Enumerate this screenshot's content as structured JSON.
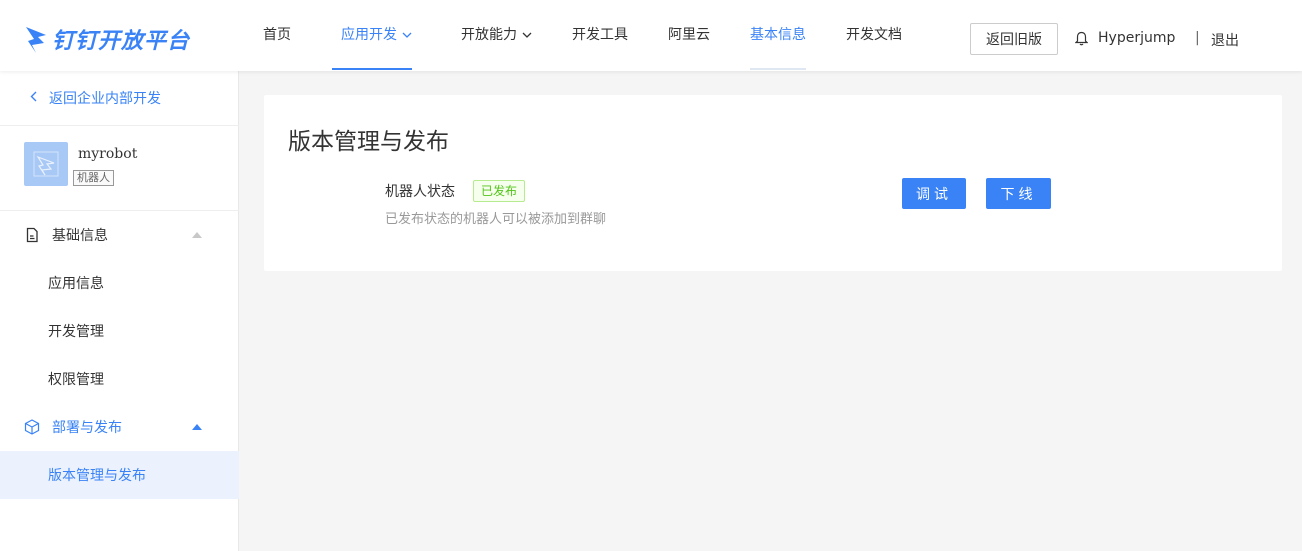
{
  "header": {
    "logo_text": "钉钉开放平台",
    "nav": [
      {
        "label": "首页"
      },
      {
        "label": "应用开发"
      },
      {
        "label": "开放能力"
      },
      {
        "label": "开发工具"
      },
      {
        "label": "阿里云"
      },
      {
        "label": "基本信息"
      },
      {
        "label": "开发文档"
      }
    ],
    "old_version_label": "返回旧版",
    "username": "Hyperjump",
    "separator": "|",
    "logout_label": "退出",
    "accent_color": "#3a83f6"
  },
  "sidebar": {
    "back_label": "返回企业内部开发",
    "app": {
      "name": "myrobot",
      "tag": "机器人"
    },
    "groups": [
      {
        "label": "基础信息",
        "icon": "document-icon",
        "expanded": true
      },
      {
        "label": "部署与发布",
        "icon": "cube-icon",
        "expanded": true
      }
    ],
    "items": [
      {
        "label": "应用信息"
      },
      {
        "label": "开发管理"
      },
      {
        "label": "权限管理"
      },
      {
        "label": "版本管理与发布"
      }
    ]
  },
  "main": {
    "title": "版本管理与发布",
    "status_label": "机器人状态",
    "status_badge": "已发布",
    "status_color": "#52c41a",
    "status_desc": "已发布状态的机器人可以被添加到群聊",
    "debug_label": "调试",
    "offline_label": "下线"
  }
}
